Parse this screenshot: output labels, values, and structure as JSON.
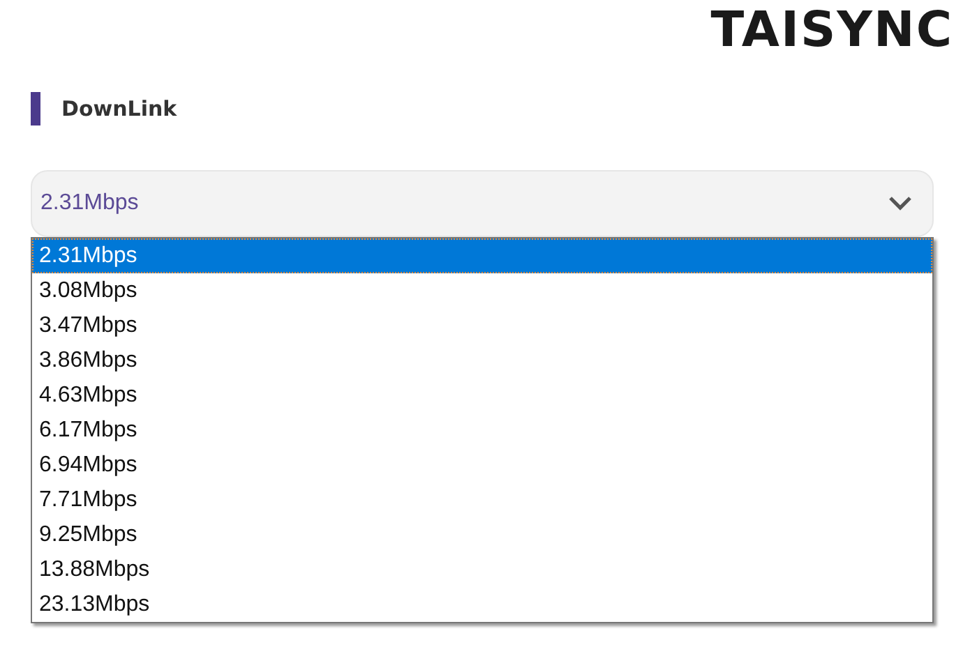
{
  "logo": "TAISYNC",
  "section": {
    "title": "DownLink"
  },
  "select": {
    "value": "2.31Mbps",
    "expanded": true,
    "options": [
      {
        "label": "2.31Mbps",
        "selected": true
      },
      {
        "label": "3.08Mbps",
        "selected": false
      },
      {
        "label": "3.47Mbps",
        "selected": false
      },
      {
        "label": "3.86Mbps",
        "selected": false
      },
      {
        "label": "4.63Mbps",
        "selected": false
      },
      {
        "label": "6.17Mbps",
        "selected": false
      },
      {
        "label": "6.94Mbps",
        "selected": false
      },
      {
        "label": "7.71Mbps",
        "selected": false
      },
      {
        "label": "9.25Mbps",
        "selected": false
      },
      {
        "label": "13.88Mbps",
        "selected": false
      },
      {
        "label": "23.13Mbps",
        "selected": false
      }
    ]
  }
}
